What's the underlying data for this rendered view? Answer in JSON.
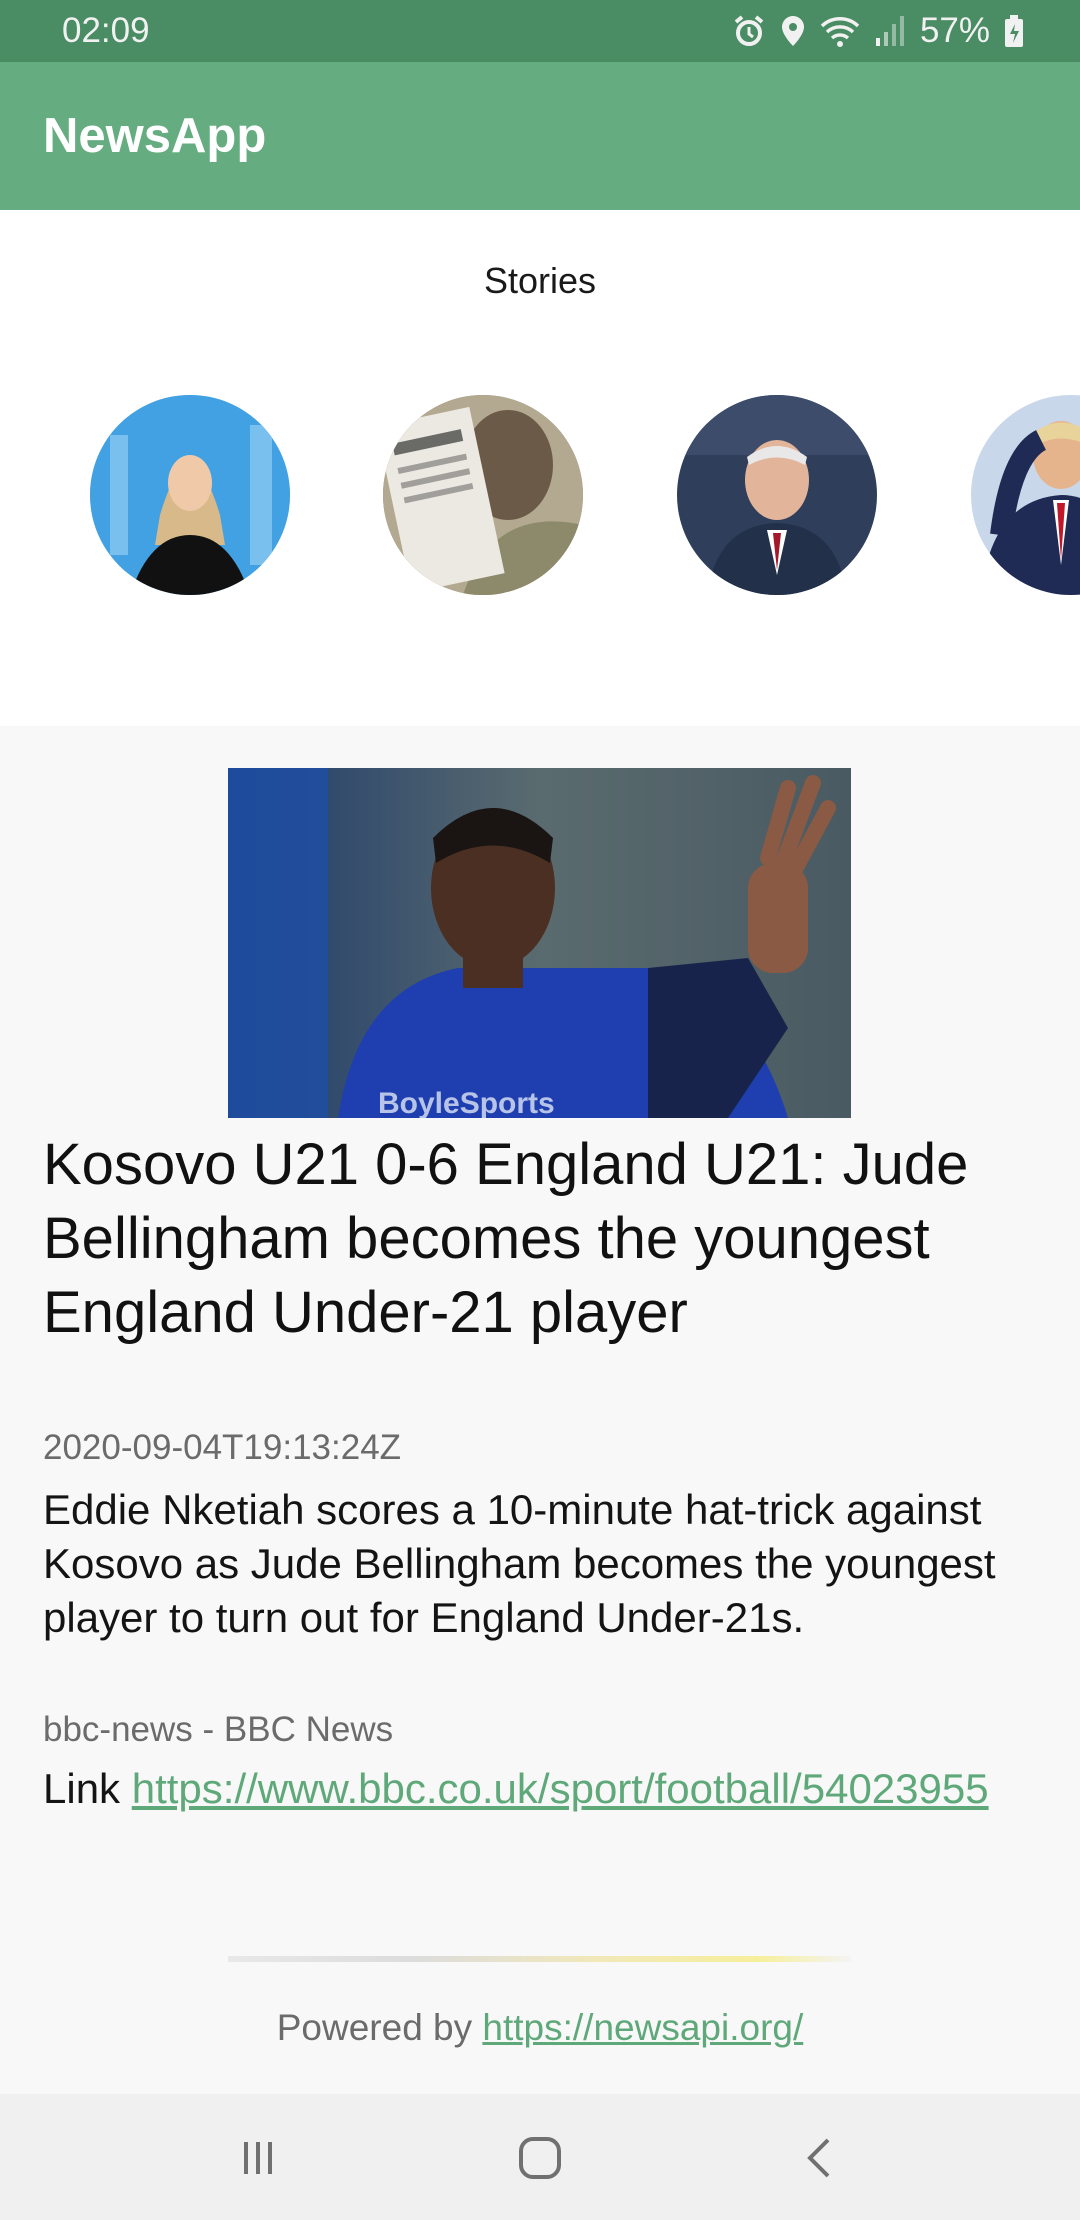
{
  "status_bar": {
    "time": "02:09",
    "battery": "57%",
    "icons": [
      "alarm-icon",
      "location-icon",
      "wifi-icon",
      "signal-icon",
      "battery-icon"
    ]
  },
  "app_bar": {
    "title": "NewsApp"
  },
  "stories": {
    "title": "Stories",
    "items": [
      "news-anchor-story",
      "newspaper-soldier-story",
      "speaker-story",
      "salute-story"
    ]
  },
  "article": {
    "headline": "Kosovo U21 0-6 England U21: Jude Bellingham becomes the youngest England Under-21 player",
    "published_at": "2020-09-04T19:13:24Z",
    "description": "Eddie Nketiah scores a 10-minute hat-trick against Kosovo as Jude Bellingham becomes the youngest player to turn out for England Under-21s.",
    "source": "bbc-news - BBC News",
    "link_label": "Link",
    "link_url": "https://www.bbc.co.uk/sport/football/54023955"
  },
  "footer": {
    "powered_by_label": "Powered by",
    "powered_by_url": "https://newsapi.org/"
  },
  "nav_bar": {
    "buttons": [
      "recents-button",
      "home-button",
      "back-button"
    ]
  },
  "colors": {
    "status_bar": "#4a8c63",
    "app_bar": "#65ac80",
    "link": "#5ea879"
  }
}
